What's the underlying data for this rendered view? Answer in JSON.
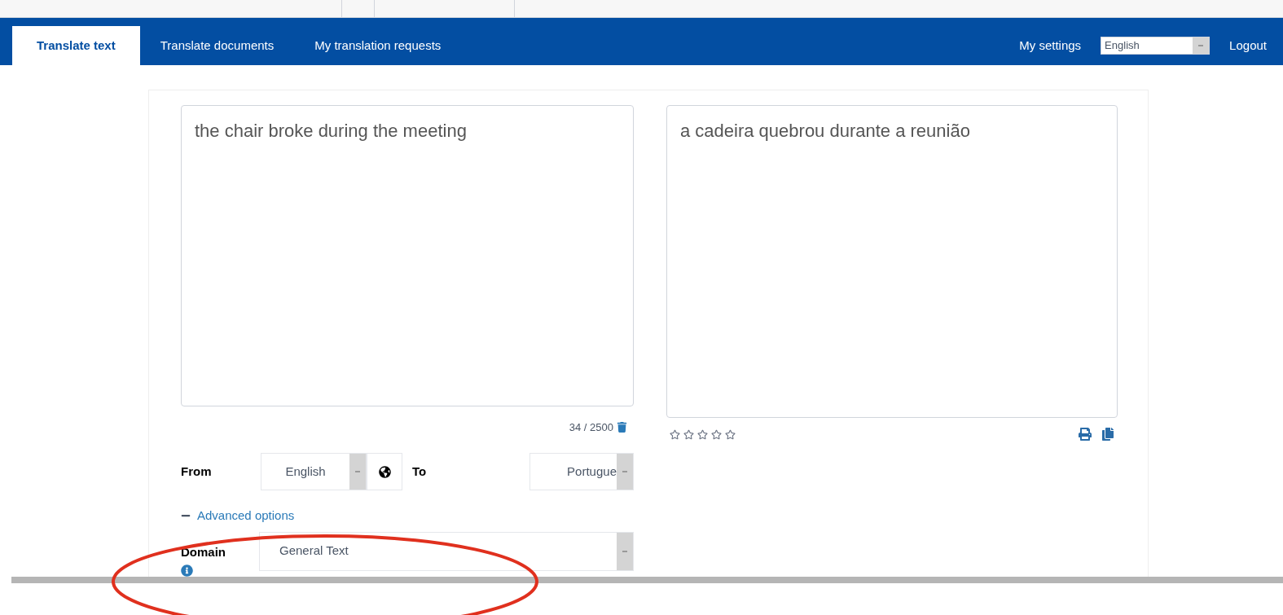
{
  "tabs": [
    {
      "label": "Translate text",
      "selected": true
    },
    {
      "label": "Translate documents",
      "selected": false
    },
    {
      "label": "My translation requests",
      "selected": false
    }
  ],
  "header": {
    "settings_link": "My settings",
    "language_select": "English",
    "logout_link": "Logout"
  },
  "source": {
    "value": "the chair broke during the meeting",
    "counter": "34 / 2500"
  },
  "target": {
    "value": "a cadeira quebrou durante a reunião",
    "stars": 0
  },
  "from": {
    "label": "From",
    "value": "English"
  },
  "to": {
    "label": "To",
    "value": "Portugue"
  },
  "advanced_options": {
    "label": "Advanced options",
    "expanded": true
  },
  "domain": {
    "label": "Domain",
    "value": "General Text"
  }
}
